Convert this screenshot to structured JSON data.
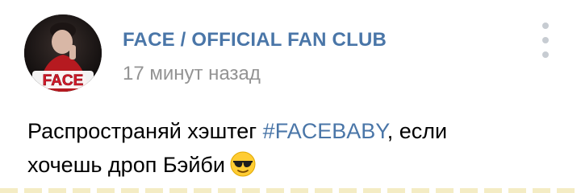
{
  "post": {
    "author": "FACE / OFFICIAL FAN CLUB",
    "timestamp": "17 минут назад",
    "avatar": {
      "badge_text": "FACE"
    },
    "menu_icon": "vertical-dots-icon",
    "text": {
      "line1_before": "Распространяй хэштег ",
      "hashtag": "#FACEBABY",
      "line1_after": ", если",
      "line2": "хочешь дроп Бэйби",
      "emoji": "sunglasses-emoji"
    }
  },
  "colors": {
    "link": "#4a76a8",
    "timestamp": "#939393",
    "text": "#000000",
    "badge_red": "#d8192a"
  }
}
